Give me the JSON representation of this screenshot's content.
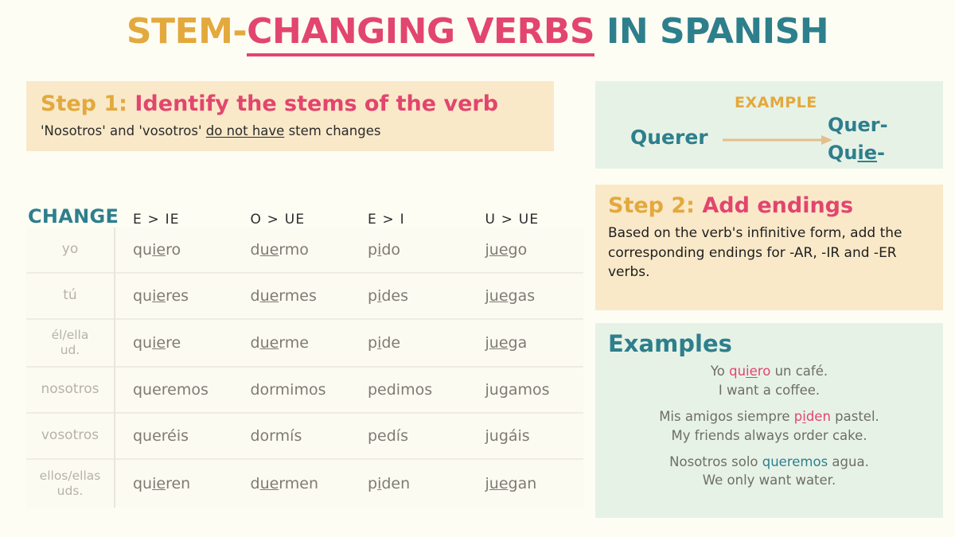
{
  "title": {
    "part1": "STEM-",
    "part2": "CHANGING VERBS",
    "part3": " IN SPANISH",
    "color_gold": "#E3A93D",
    "color_pink": "#E2456E",
    "color_teal": "#2E7F8C"
  },
  "step1": {
    "label": "Step 1:",
    "heading": " Identify the stems of the verb",
    "sub_pre": "'Nosotros' and 'vosotros' ",
    "sub_underlined": "do not have",
    "sub_post": " stem changes"
  },
  "example": {
    "label": "EXAMPLE",
    "verb": "Querer",
    "result_line1": "Quer-",
    "result_line2_pre": "Qu",
    "result_line2_underlined": "ie",
    "result_line2_post": "-",
    "arrow_color": "#E3C08A"
  },
  "step2": {
    "label": "Step 2:",
    "heading": " Add endings",
    "body": "Based on the verb's infinitive form, add the corresponding endings for -AR, -IR and -ER verbs."
  },
  "examples": {
    "heading": "Examples",
    "items": [
      {
        "es_pre": "Yo ",
        "es_hi_pre": "qu",
        "es_hi_u": "ie",
        "es_hi_post": "ro",
        "es_post": " un café.",
        "hi_color": "pink",
        "en": "I want a coffee."
      },
      {
        "es_pre": "Mis amigos siempre ",
        "es_hi_pre": "p",
        "es_hi_u": "i",
        "es_hi_post": "den",
        "es_post": " pastel.",
        "hi_color": "pink",
        "en": "My friends always order cake."
      },
      {
        "es_pre": "Nosotros solo ",
        "es_hi_pre": "queremos",
        "es_hi_u": "",
        "es_hi_post": "",
        "es_post": " agua.",
        "hi_color": "teal",
        "en": "We only want water."
      }
    ]
  },
  "table": {
    "change_header": "CHANGE",
    "columns": [
      "E > IE",
      "O > UE",
      "E > I",
      "U > UE"
    ],
    "rows": [
      {
        "pronoun": "yo",
        "pronoun_line2": "",
        "cells": [
          {
            "pre": "qu",
            "u": "ie",
            "post": "ro"
          },
          {
            "pre": "d",
            "u": "ue",
            "post": "rmo"
          },
          {
            "pre": "p",
            "u": "i",
            "post": "do"
          },
          {
            "pre": "j",
            "u": "ue",
            "post": "go"
          }
        ]
      },
      {
        "pronoun": "tú",
        "pronoun_line2": "",
        "cells": [
          {
            "pre": "qu",
            "u": "ie",
            "post": "res"
          },
          {
            "pre": "d",
            "u": "ue",
            "post": "rmes"
          },
          {
            "pre": "p",
            "u": "i",
            "post": "des"
          },
          {
            "pre": "j",
            "u": "ue",
            "post": "gas"
          }
        ]
      },
      {
        "pronoun": "él/ella",
        "pronoun_line2": "ud.",
        "cells": [
          {
            "pre": "qu",
            "u": "ie",
            "post": "re"
          },
          {
            "pre": "d",
            "u": "ue",
            "post": "rme"
          },
          {
            "pre": "p",
            "u": "i",
            "post": "de"
          },
          {
            "pre": "j",
            "u": "ue",
            "post": "ga"
          }
        ]
      },
      {
        "pronoun": "nosotros",
        "pronoun_line2": "",
        "cells": [
          {
            "pre": "queremos",
            "u": "",
            "post": ""
          },
          {
            "pre": "dormimos",
            "u": "",
            "post": ""
          },
          {
            "pre": "pedimos",
            "u": "",
            "post": ""
          },
          {
            "pre": "jugamos",
            "u": "",
            "post": ""
          }
        ]
      },
      {
        "pronoun": "vosotros",
        "pronoun_line2": "",
        "cells": [
          {
            "pre": "queréis",
            "u": "",
            "post": ""
          },
          {
            "pre": "dormís",
            "u": "",
            "post": ""
          },
          {
            "pre": "pedís",
            "u": "",
            "post": ""
          },
          {
            "pre": "jugáis",
            "u": "",
            "post": ""
          }
        ]
      },
      {
        "pronoun": "ellos/ellas",
        "pronoun_line2": "uds.",
        "cells": [
          {
            "pre": "qu",
            "u": "ie",
            "post": "ren"
          },
          {
            "pre": "d",
            "u": "ue",
            "post": "rmen"
          },
          {
            "pre": "p",
            "u": "i",
            "post": "den"
          },
          {
            "pre": "j",
            "u": "ue",
            "post": "gan"
          }
        ]
      }
    ]
  }
}
